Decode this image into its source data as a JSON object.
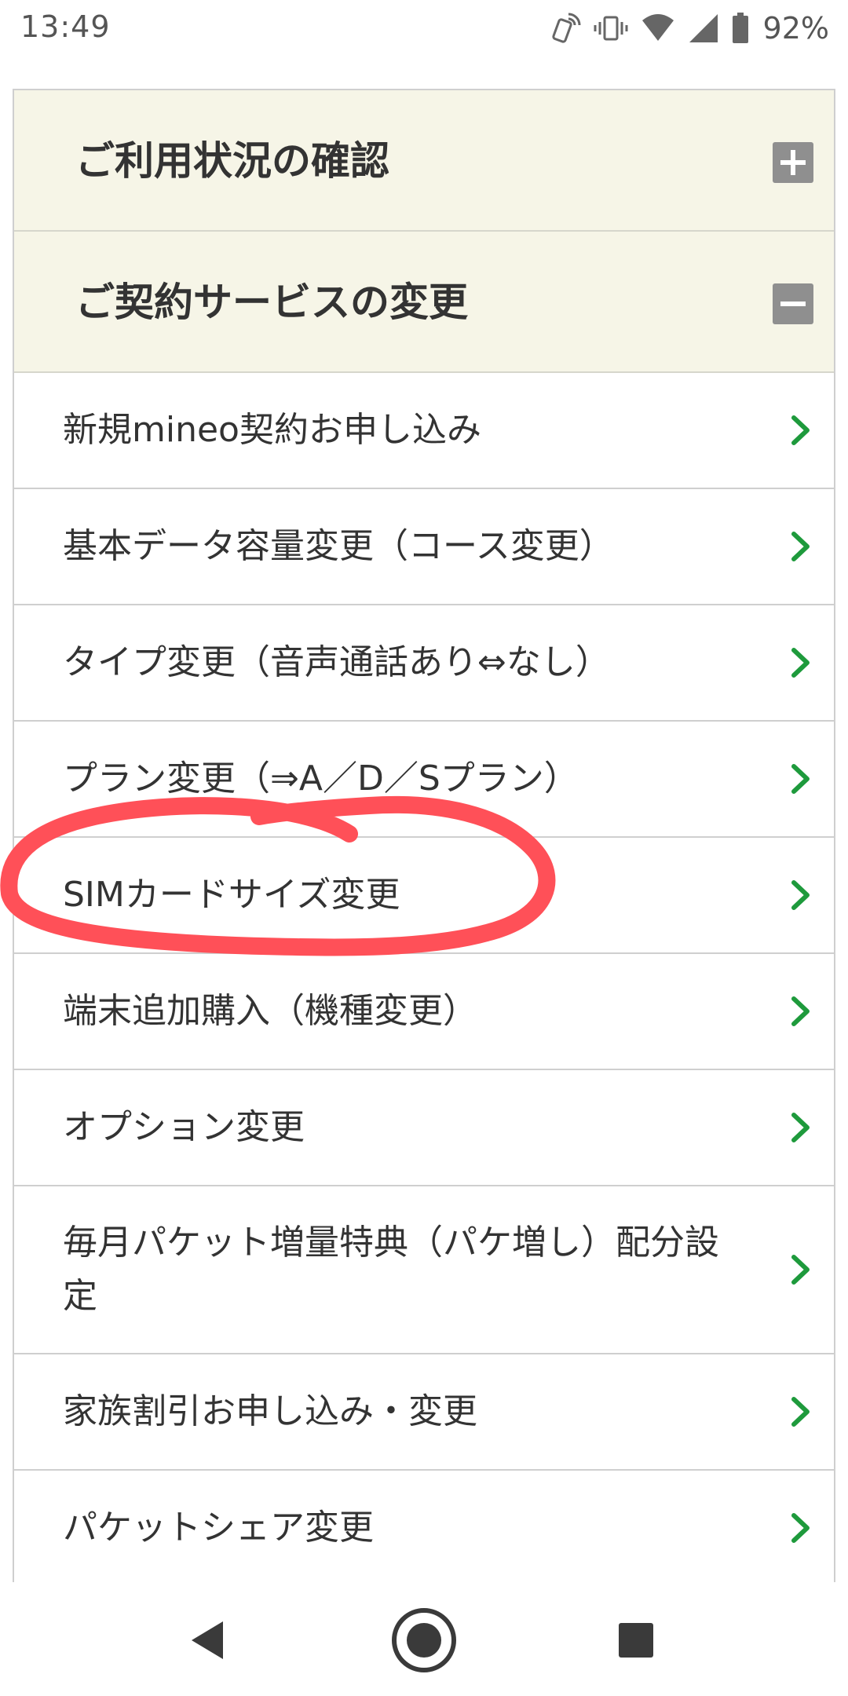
{
  "status_bar": {
    "time": "13:49",
    "battery": "92%",
    "icons": [
      "nfc-phone-icon",
      "vibrate-icon",
      "wifi-icon",
      "signal-icon",
      "battery-icon"
    ]
  },
  "sections": [
    {
      "title": "ご利用状況の確認",
      "expanded": false,
      "toggle_icon": "plus-icon"
    },
    {
      "title": "ご契約サービスの変更",
      "expanded": true,
      "toggle_icon": "minus-icon"
    }
  ],
  "menu_items": [
    {
      "label": "新規mineo契約お申し込み"
    },
    {
      "label": "基本データ容量変更（コース変更）"
    },
    {
      "label": "タイプ変更（音声通話あり⇔なし）"
    },
    {
      "label": "プラン変更（⇒A／D／Sプラン）"
    },
    {
      "label": "SIMカードサイズ変更",
      "circled": true
    },
    {
      "label": "端末追加購入（機種変更）"
    },
    {
      "label": "オプション変更"
    },
    {
      "label": "毎月パケット増量特典（パケ増し）配分設定"
    },
    {
      "label": "家族割引お申し込み・変更"
    },
    {
      "label": "パケットシェア変更"
    }
  ],
  "colors": {
    "section_bg": "#f6f5e7",
    "chevron": "#1e9a3c",
    "toggle": "#8f8f8f",
    "annotation": "#ff5058"
  },
  "nav_bar": {
    "buttons": [
      "back-icon",
      "home-icon",
      "recents-icon"
    ]
  }
}
